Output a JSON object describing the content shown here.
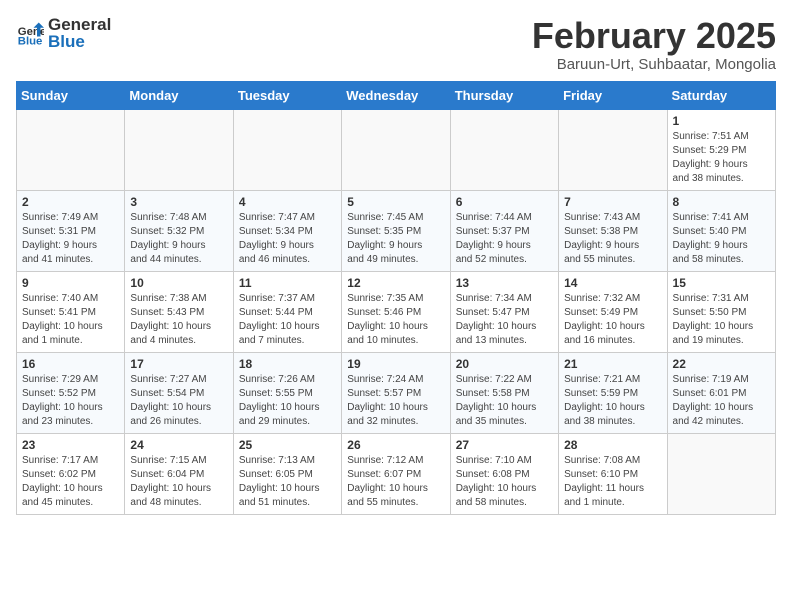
{
  "header": {
    "logo_general": "General",
    "logo_blue": "Blue",
    "month_year": "February 2025",
    "location": "Baruun-Urt, Suhbaatar, Mongolia"
  },
  "weekdays": [
    "Sunday",
    "Monday",
    "Tuesday",
    "Wednesday",
    "Thursday",
    "Friday",
    "Saturday"
  ],
  "weeks": [
    [
      {
        "day": "",
        "info": ""
      },
      {
        "day": "",
        "info": ""
      },
      {
        "day": "",
        "info": ""
      },
      {
        "day": "",
        "info": ""
      },
      {
        "day": "",
        "info": ""
      },
      {
        "day": "",
        "info": ""
      },
      {
        "day": "1",
        "info": "Sunrise: 7:51 AM\nSunset: 5:29 PM\nDaylight: 9 hours\nand 38 minutes."
      }
    ],
    [
      {
        "day": "2",
        "info": "Sunrise: 7:49 AM\nSunset: 5:31 PM\nDaylight: 9 hours\nand 41 minutes."
      },
      {
        "day": "3",
        "info": "Sunrise: 7:48 AM\nSunset: 5:32 PM\nDaylight: 9 hours\nand 44 minutes."
      },
      {
        "day": "4",
        "info": "Sunrise: 7:47 AM\nSunset: 5:34 PM\nDaylight: 9 hours\nand 46 minutes."
      },
      {
        "day": "5",
        "info": "Sunrise: 7:45 AM\nSunset: 5:35 PM\nDaylight: 9 hours\nand 49 minutes."
      },
      {
        "day": "6",
        "info": "Sunrise: 7:44 AM\nSunset: 5:37 PM\nDaylight: 9 hours\nand 52 minutes."
      },
      {
        "day": "7",
        "info": "Sunrise: 7:43 AM\nSunset: 5:38 PM\nDaylight: 9 hours\nand 55 minutes."
      },
      {
        "day": "8",
        "info": "Sunrise: 7:41 AM\nSunset: 5:40 PM\nDaylight: 9 hours\nand 58 minutes."
      }
    ],
    [
      {
        "day": "9",
        "info": "Sunrise: 7:40 AM\nSunset: 5:41 PM\nDaylight: 10 hours\nand 1 minute."
      },
      {
        "day": "10",
        "info": "Sunrise: 7:38 AM\nSunset: 5:43 PM\nDaylight: 10 hours\nand 4 minutes."
      },
      {
        "day": "11",
        "info": "Sunrise: 7:37 AM\nSunset: 5:44 PM\nDaylight: 10 hours\nand 7 minutes."
      },
      {
        "day": "12",
        "info": "Sunrise: 7:35 AM\nSunset: 5:46 PM\nDaylight: 10 hours\nand 10 minutes."
      },
      {
        "day": "13",
        "info": "Sunrise: 7:34 AM\nSunset: 5:47 PM\nDaylight: 10 hours\nand 13 minutes."
      },
      {
        "day": "14",
        "info": "Sunrise: 7:32 AM\nSunset: 5:49 PM\nDaylight: 10 hours\nand 16 minutes."
      },
      {
        "day": "15",
        "info": "Sunrise: 7:31 AM\nSunset: 5:50 PM\nDaylight: 10 hours\nand 19 minutes."
      }
    ],
    [
      {
        "day": "16",
        "info": "Sunrise: 7:29 AM\nSunset: 5:52 PM\nDaylight: 10 hours\nand 23 minutes."
      },
      {
        "day": "17",
        "info": "Sunrise: 7:27 AM\nSunset: 5:54 PM\nDaylight: 10 hours\nand 26 minutes."
      },
      {
        "day": "18",
        "info": "Sunrise: 7:26 AM\nSunset: 5:55 PM\nDaylight: 10 hours\nand 29 minutes."
      },
      {
        "day": "19",
        "info": "Sunrise: 7:24 AM\nSunset: 5:57 PM\nDaylight: 10 hours\nand 32 minutes."
      },
      {
        "day": "20",
        "info": "Sunrise: 7:22 AM\nSunset: 5:58 PM\nDaylight: 10 hours\nand 35 minutes."
      },
      {
        "day": "21",
        "info": "Sunrise: 7:21 AM\nSunset: 5:59 PM\nDaylight: 10 hours\nand 38 minutes."
      },
      {
        "day": "22",
        "info": "Sunrise: 7:19 AM\nSunset: 6:01 PM\nDaylight: 10 hours\nand 42 minutes."
      }
    ],
    [
      {
        "day": "23",
        "info": "Sunrise: 7:17 AM\nSunset: 6:02 PM\nDaylight: 10 hours\nand 45 minutes."
      },
      {
        "day": "24",
        "info": "Sunrise: 7:15 AM\nSunset: 6:04 PM\nDaylight: 10 hours\nand 48 minutes."
      },
      {
        "day": "25",
        "info": "Sunrise: 7:13 AM\nSunset: 6:05 PM\nDaylight: 10 hours\nand 51 minutes."
      },
      {
        "day": "26",
        "info": "Sunrise: 7:12 AM\nSunset: 6:07 PM\nDaylight: 10 hours\nand 55 minutes."
      },
      {
        "day": "27",
        "info": "Sunrise: 7:10 AM\nSunset: 6:08 PM\nDaylight: 10 hours\nand 58 minutes."
      },
      {
        "day": "28",
        "info": "Sunrise: 7:08 AM\nSunset: 6:10 PM\nDaylight: 11 hours\nand 1 minute."
      },
      {
        "day": "",
        "info": ""
      }
    ]
  ]
}
